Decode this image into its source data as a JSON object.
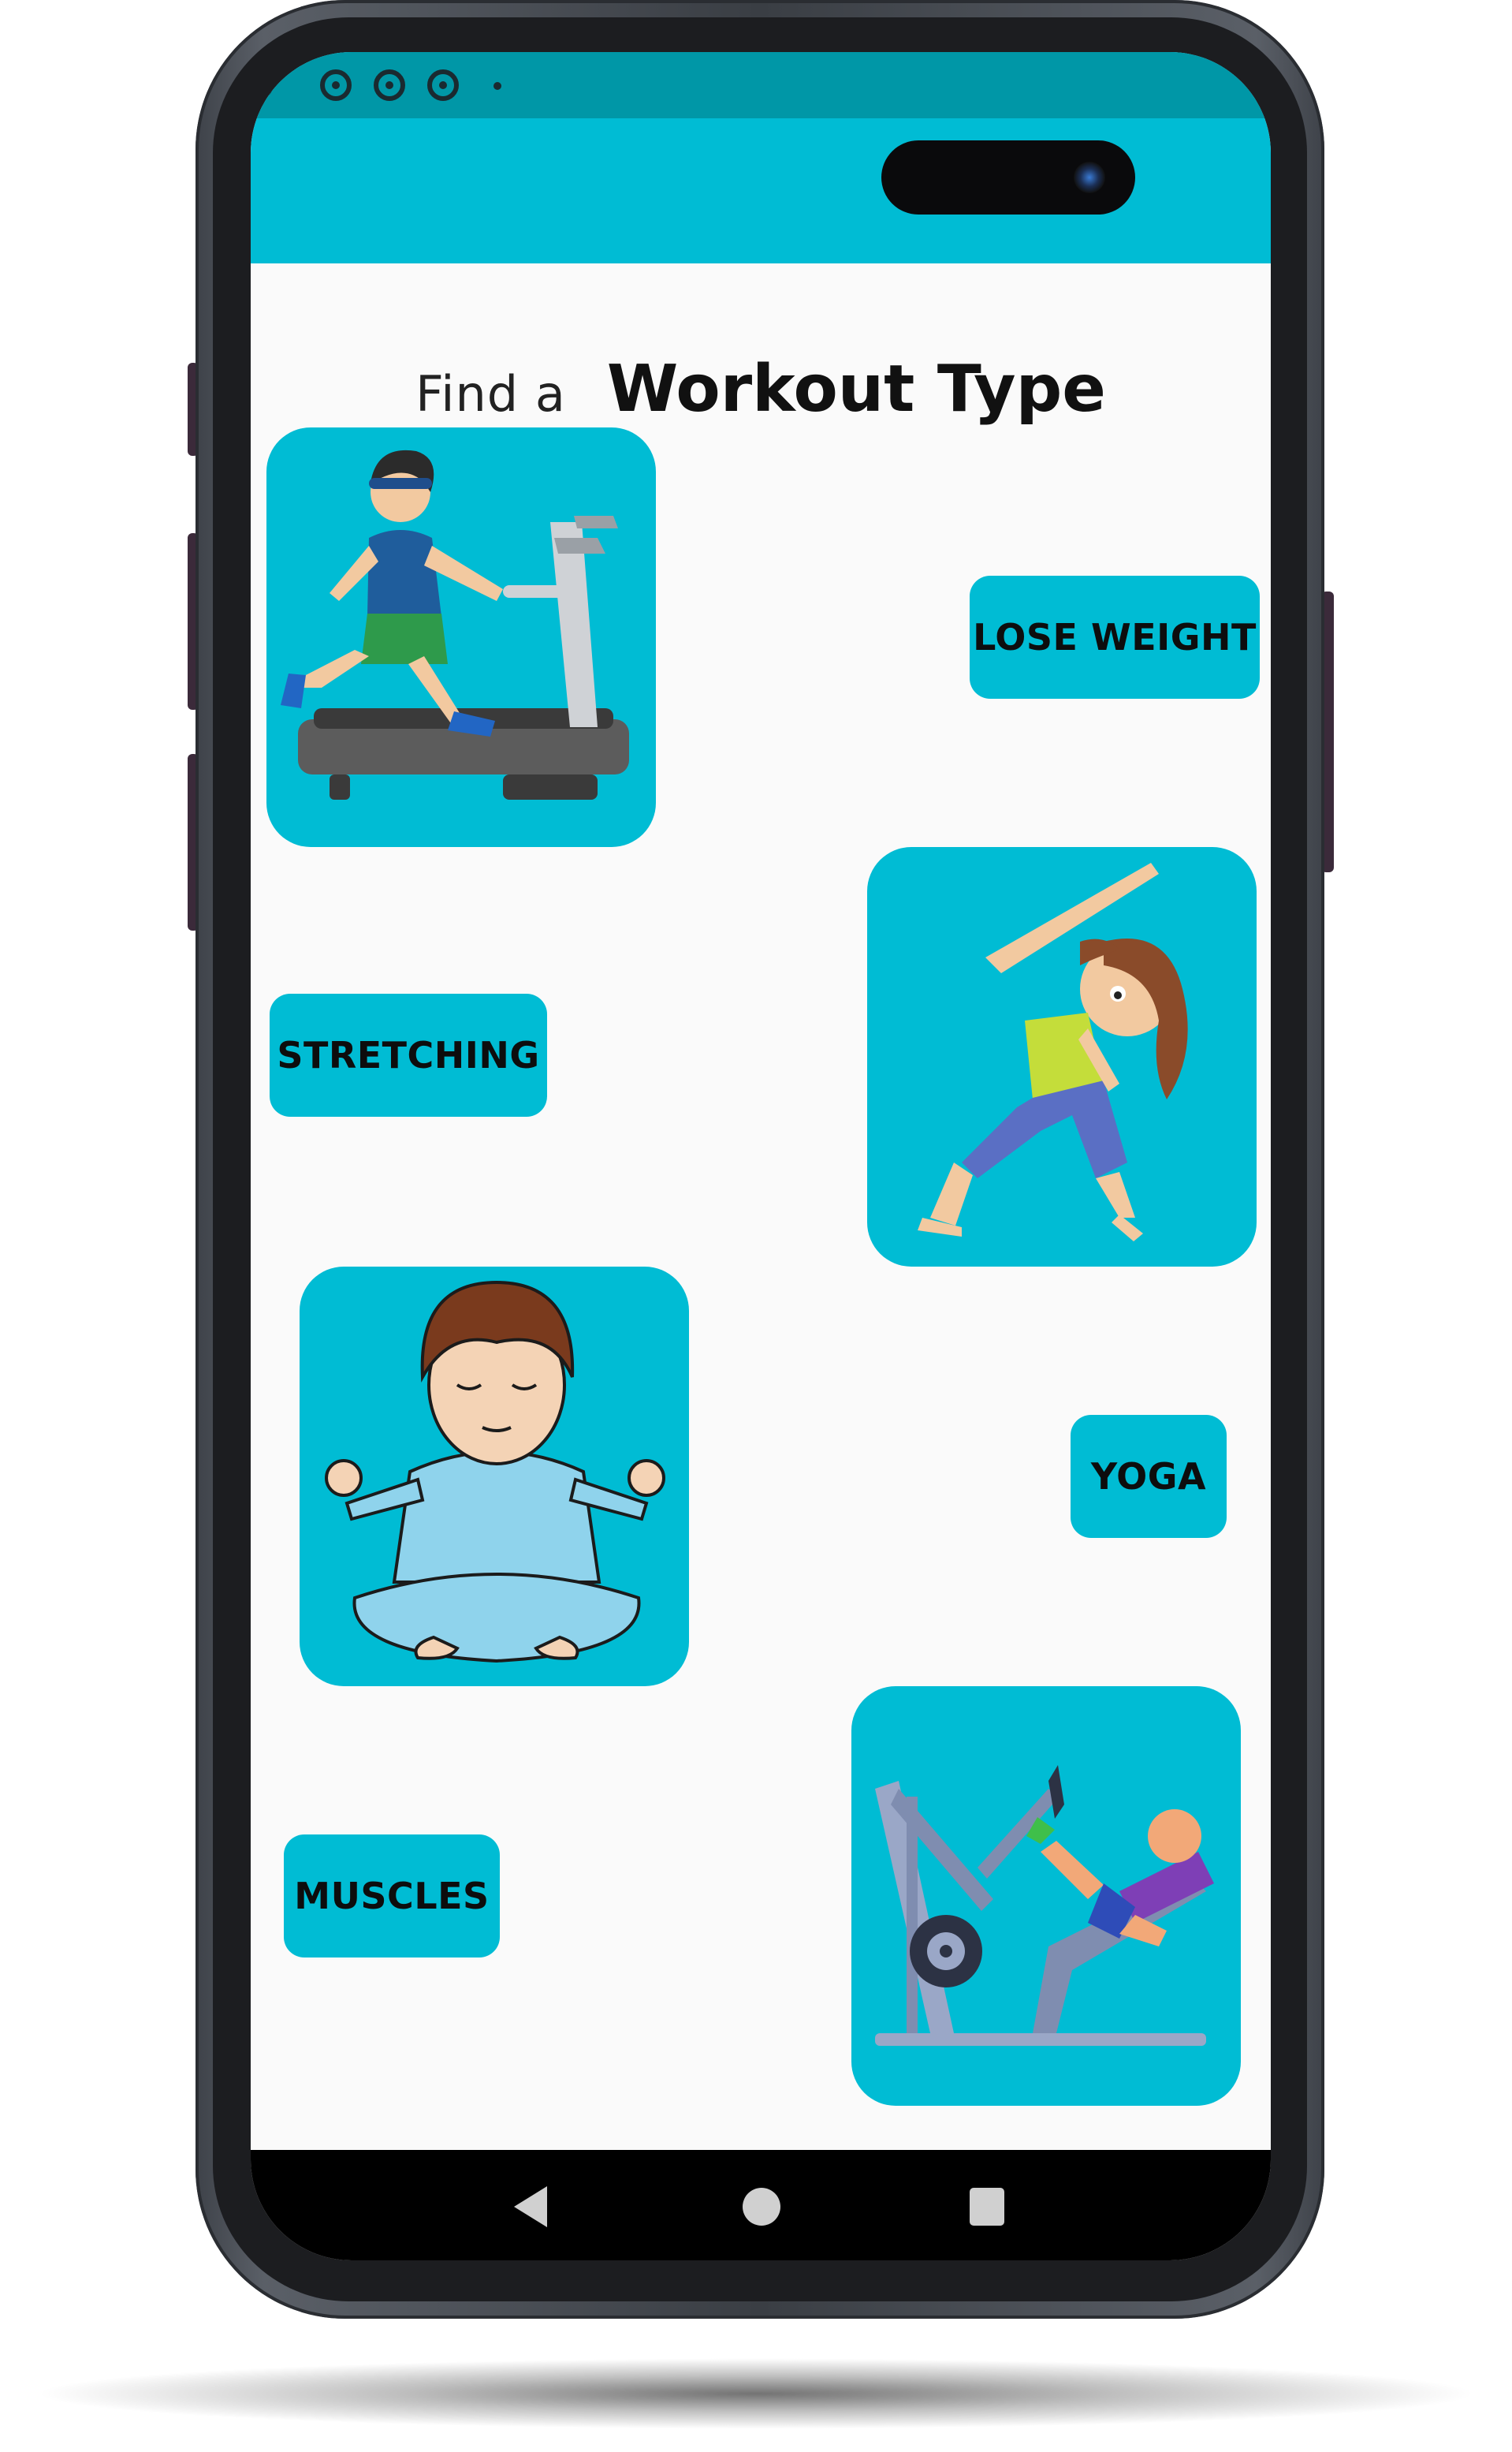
{
  "header": {
    "title_prefix": "Find a",
    "title_main": "Workout Type"
  },
  "workouts": [
    {
      "label": "LOSE WEIGHT",
      "illustration": "treadmill-runner-icon"
    },
    {
      "label": "STRETCHING",
      "illustration": "stretching-girl-icon"
    },
    {
      "label": "YOGA",
      "illustration": "meditating-man-icon"
    },
    {
      "label": "MUSCLES",
      "illustration": "leg-press-machine-icon"
    }
  ],
  "status_bar": {
    "icons": [
      "chrome-icon",
      "chrome-icon",
      "chrome-icon",
      "notification-dot-icon"
    ]
  },
  "navigation": {
    "buttons": [
      "back-icon",
      "home-icon",
      "recents-icon"
    ]
  },
  "colors": {
    "accent": "#00bcd4",
    "status_bar": "#0097a7",
    "screen_background": "#fafafa",
    "nav_bar": "#000000",
    "button_text": "#0d0d0d"
  }
}
